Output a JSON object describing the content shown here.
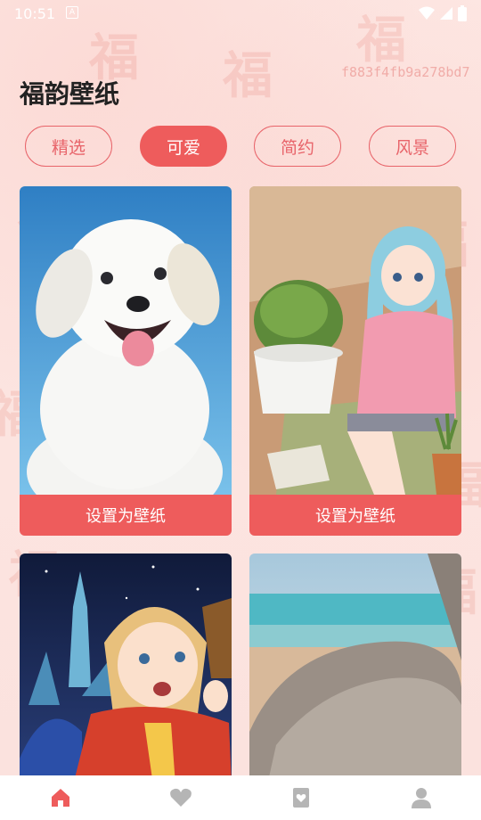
{
  "status": {
    "time": "10:51",
    "app_indicator": "A"
  },
  "watermark": "f883f4fb9a278bd7",
  "page_title": "福韵壁纸",
  "tabs": [
    {
      "label": "精选",
      "active": false
    },
    {
      "label": "可爱",
      "active": true
    },
    {
      "label": "简约",
      "active": false
    },
    {
      "label": "风景",
      "active": false
    }
  ],
  "cards": [
    {
      "image": "white puppy on blue sky",
      "button": "设置为壁纸"
    },
    {
      "image": "anime girl with plant",
      "button": "设置为壁纸"
    },
    {
      "image": "anime girl at night castle",
      "button": ""
    },
    {
      "image": "beach with blurred pillow",
      "button": ""
    }
  ],
  "nav": [
    {
      "icon": "home-icon",
      "active": true
    },
    {
      "icon": "heart-icon",
      "active": false
    },
    {
      "icon": "card-heart-icon",
      "active": false
    },
    {
      "icon": "user-icon",
      "active": false
    }
  ],
  "colors": {
    "accent": "#ee5c5c",
    "background": "#fde8e4"
  }
}
